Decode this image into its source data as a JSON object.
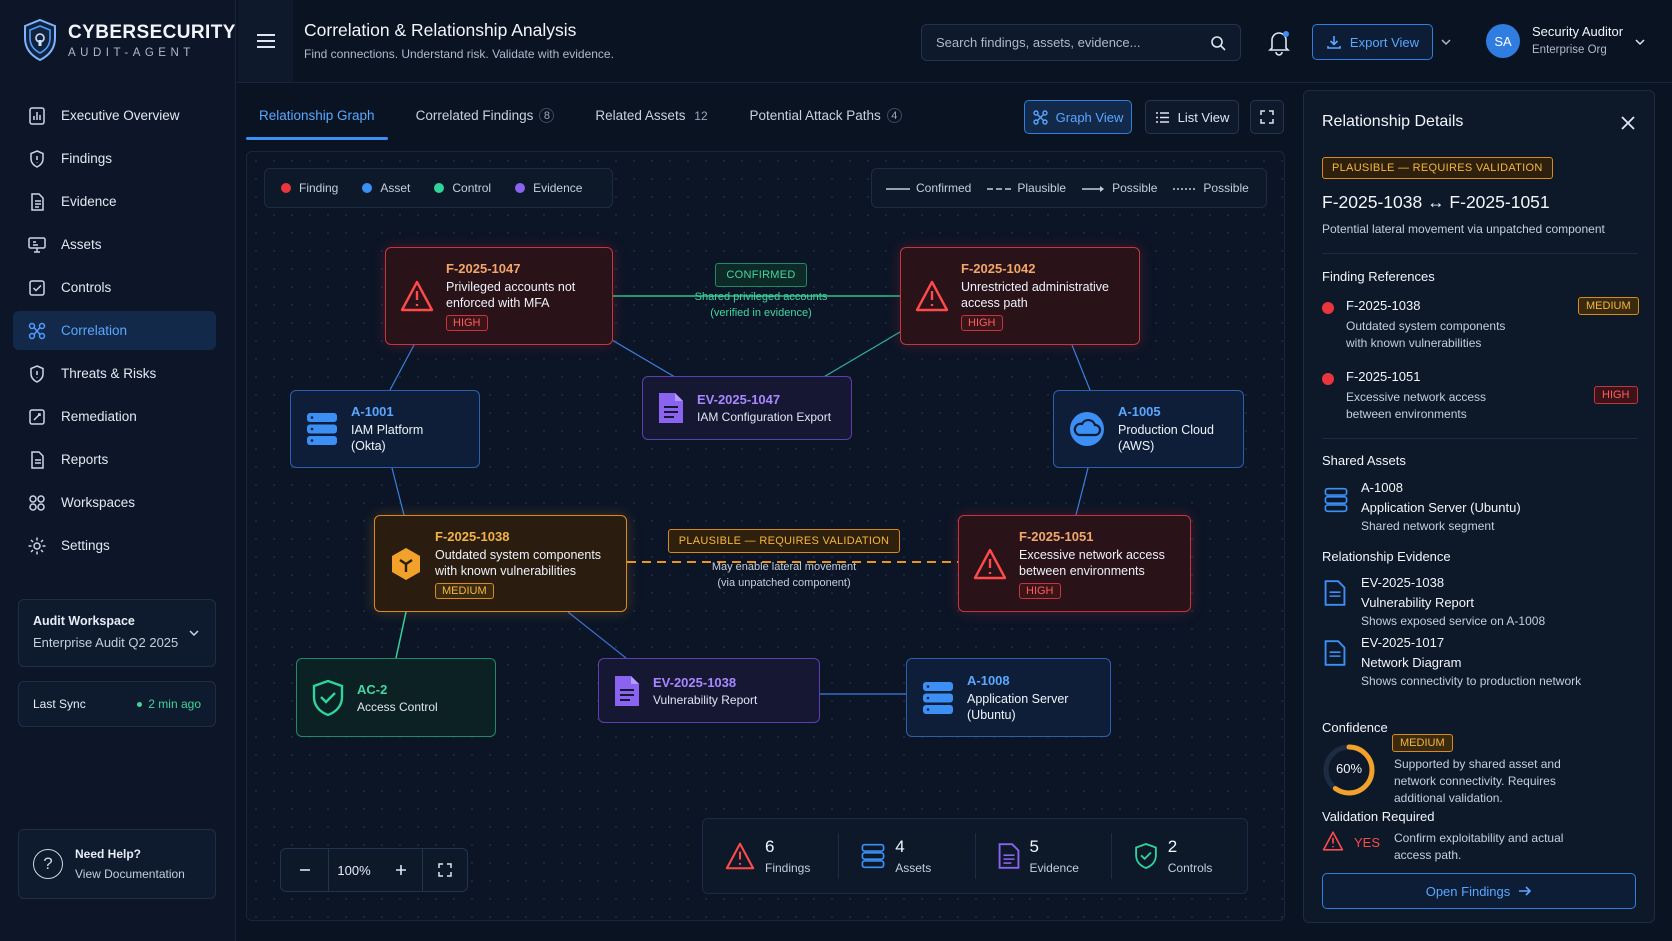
{
  "brand": {
    "name": "CYBERSECURITY",
    "sub": "AUDIT-AGENT"
  },
  "header": {
    "title": "Correlation & Relationship Analysis",
    "subtitle": "Find connections. Understand risk. Validate with evidence."
  },
  "search": {
    "placeholder": "Search findings, assets, evidence..."
  },
  "export": {
    "label": "Export View"
  },
  "user": {
    "initials": "SA",
    "name": "Security Auditor",
    "org": "Enterprise Org"
  },
  "sidebar": {
    "items": [
      {
        "label": "Executive Overview",
        "icon": "overview-icon"
      },
      {
        "label": "Findings",
        "icon": "findings-icon"
      },
      {
        "label": "Evidence",
        "icon": "evidence-icon"
      },
      {
        "label": "Assets",
        "icon": "assets-icon"
      },
      {
        "label": "Controls",
        "icon": "controls-icon"
      },
      {
        "label": "Correlation",
        "icon": "correlation-icon",
        "active": true
      },
      {
        "label": "Threats & Risks",
        "icon": "threats-icon"
      },
      {
        "label": "Remediation",
        "icon": "remediation-icon"
      },
      {
        "label": "Reports",
        "icon": "reports-icon"
      },
      {
        "label": "Workspaces",
        "icon": "workspaces-icon"
      },
      {
        "label": "Settings",
        "icon": "settings-icon"
      }
    ],
    "workspace": {
      "label": "Audit Workspace",
      "value": "Enterprise Audit Q2 2025"
    },
    "sync": {
      "label": "Last Sync",
      "value": "2 min ago"
    },
    "help": {
      "title": "Need Help?",
      "link": "View Documentation"
    }
  },
  "tabs": [
    {
      "label": "Relationship Graph",
      "count": ""
    },
    {
      "label": "Correlated Findings",
      "count": "8"
    },
    {
      "label": "Related Assets",
      "count": "12"
    },
    {
      "label": "Potential Attack Paths",
      "count": "4"
    }
  ],
  "views": {
    "graph": "Graph View",
    "list": "List View"
  },
  "legend": {
    "types": [
      {
        "label": "Finding",
        "color": "#e8363c"
      },
      {
        "label": "Asset",
        "color": "#3b8ff5"
      },
      {
        "label": "Control",
        "color": "#2fd49a"
      },
      {
        "label": "Evidence",
        "color": "#8a63f0"
      }
    ],
    "lines": [
      "Confirmed",
      "Plausible",
      "Possible",
      "Possible"
    ]
  },
  "nodes": {
    "f1047": {
      "id": "F-2025-1047",
      "text": "Privileged accounts not enforced with MFA",
      "sev": "HIGH"
    },
    "f1042": {
      "id": "F-2025-1042",
      "text": "Unrestricted administrative access path",
      "sev": "HIGH"
    },
    "a1001": {
      "id": "A-1001",
      "text": "IAM Platform (Okta)"
    },
    "ev1047": {
      "id": "EV-2025-1047",
      "text": "IAM Configuration Export"
    },
    "a1005": {
      "id": "A-1005",
      "text": "Production Cloud (AWS)"
    },
    "f1038": {
      "id": "F-2025-1038",
      "text": "Outdated system components with known vulnerabilities",
      "sev": "MEDIUM"
    },
    "f1051": {
      "id": "F-2025-1051",
      "text": "Excessive network access between environments",
      "sev": "HIGH"
    },
    "ac2": {
      "id": "AC-2",
      "text": "Access Control"
    },
    "ev1038": {
      "id": "EV-2025-1038",
      "text": "Vulnerability Report"
    },
    "a1008": {
      "id": "A-1008",
      "text": "Application Server (Ubuntu)"
    }
  },
  "edge_labels": {
    "confirmed": {
      "chip": "CONFIRMED",
      "text1": "Shared privileged accounts",
      "text2": "(verified in evidence)"
    },
    "plausible": {
      "chip": "PLAUSIBLE — REQUIRES VALIDATION",
      "text1": "May enable lateral movement",
      "text2": "(via unpatched component)"
    }
  },
  "zoom": {
    "level": "100%"
  },
  "stats": [
    {
      "value": "6",
      "label": "Findings"
    },
    {
      "value": "4",
      "label": "Assets"
    },
    {
      "value": "5",
      "label": "Evidence"
    },
    {
      "value": "2",
      "label": "Controls"
    }
  ],
  "details": {
    "title": "Relationship Details",
    "status": "PLAUSIBLE — REQUIRES VALIDATION",
    "pair": "F-2025-1038 ↔ F-2025-1051",
    "desc": "Potential lateral movement via unpatched component",
    "finding_refs_title": "Finding References",
    "finding_refs": [
      {
        "id": "F-2025-1038",
        "desc": "Outdated system components with known vulnerabilities",
        "sev": "MEDIUM"
      },
      {
        "id": "F-2025-1051",
        "desc": "Excessive network access between environments",
        "sev": "HIGH"
      }
    ],
    "shared_title": "Shared Assets",
    "shared": {
      "id": "A-1008",
      "name": "Application Server (Ubuntu)",
      "desc": "Shared network segment"
    },
    "evidence_title": "Relationship Evidence",
    "evidence": [
      {
        "id": "EV-2025-1038",
        "name": "Vulnerability Report",
        "desc": "Shows exposed service on A-1008"
      },
      {
        "id": "EV-2025-1017",
        "name": "Network Diagram",
        "desc": "Shows connectivity to production network"
      }
    ],
    "confidence_title": "Confidence",
    "confidence_level": "MEDIUM",
    "confidence_value": "60%",
    "confidence_fraction": 0.6,
    "confidence_desc": "Supported by shared asset and network connectivity. Requires additional validation.",
    "validation_title": "Validation Required",
    "validation_value": "YES",
    "validation_desc": "Confirm exploitability and actual access path.",
    "open_btn": "Open Findings"
  }
}
